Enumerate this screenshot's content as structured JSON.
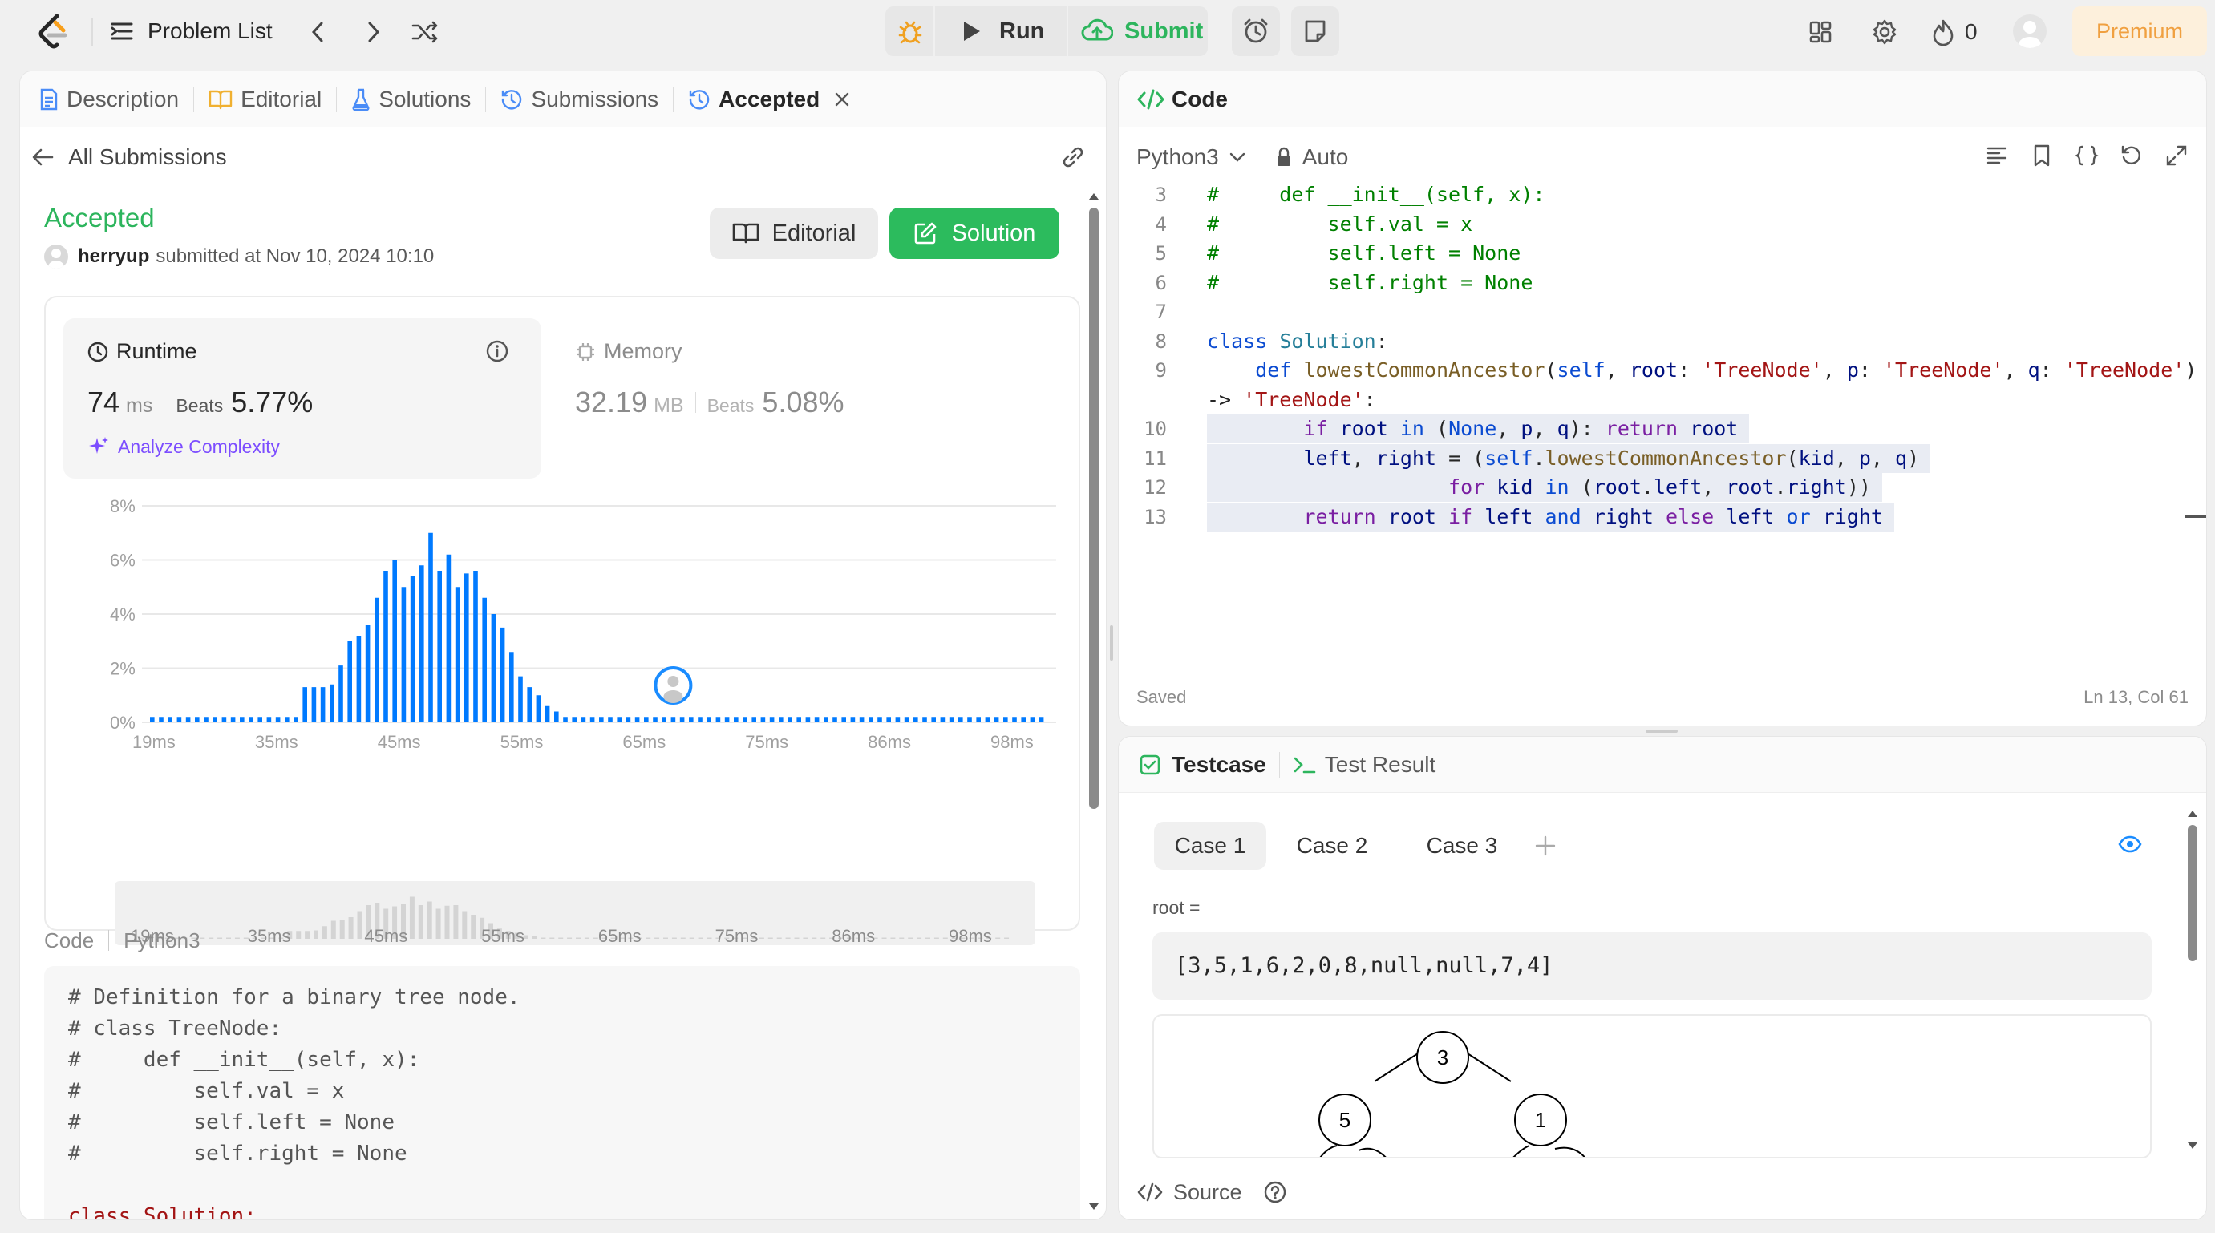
{
  "topbar": {
    "problem_list": "Problem List",
    "run": "Run",
    "submit": "Submit",
    "streak": "0",
    "premium": "Premium"
  },
  "left_tabs": {
    "description": "Description",
    "editorial": "Editorial",
    "solutions": "Solutions",
    "submissions": "Submissions",
    "accepted": "Accepted"
  },
  "submission": {
    "back_label": "All Submissions",
    "status": "Accepted",
    "user": "herryup",
    "submitted_text": "submitted at Nov 10, 2024 10:10",
    "editorial_btn": "Editorial",
    "solution_btn": "Solution"
  },
  "runtime": {
    "label": "Runtime",
    "value": "74",
    "unit": "ms",
    "beats_label": "Beats",
    "beats_value": "5.77%",
    "analyze": "Analyze Complexity"
  },
  "memory": {
    "label": "Memory",
    "value": "32.19",
    "unit": "MB",
    "beats_label": "Beats",
    "beats_value": "5.08%"
  },
  "chart_data": {
    "type": "bar",
    "y_ticks": [
      "8%",
      "6%",
      "4%",
      "2%",
      "0%"
    ],
    "ylim": [
      0,
      8
    ],
    "x_ticks": [
      "19ms",
      "35ms",
      "45ms",
      "55ms",
      "65ms",
      "75ms",
      "86ms",
      "98ms"
    ],
    "mini_x_ticks": [
      "19ms",
      "35ms",
      "45ms",
      "55ms",
      "65ms",
      "75ms",
      "86ms",
      "98ms"
    ],
    "values": [
      0.2,
      0.2,
      0.2,
      0.2,
      0.2,
      0.2,
      0.2,
      0.2,
      0.2,
      0.2,
      0.2,
      0.2,
      0.2,
      0.2,
      0.2,
      0.2,
      0.2,
      1.3,
      1.3,
      1.3,
      1.4,
      2.1,
      3.0,
      3.2,
      3.6,
      4.6,
      5.6,
      6.0,
      5.0,
      5.4,
      5.8,
      7.0,
      5.6,
      6.2,
      5.0,
      5.5,
      5.6,
      4.6,
      4.0,
      3.5,
      2.6,
      1.7,
      1.3,
      1.0,
      0.6,
      0.4,
      0.2,
      0.2,
      0.2,
      0.2,
      0.2,
      0.2,
      0.2,
      0.2,
      0.2,
      0.2,
      0.2,
      0.2,
      0.2,
      0.2,
      0.2,
      0.2,
      0.2,
      0.2,
      0.2,
      0.2,
      0.2,
      0.2,
      0.2,
      0.2,
      0.2,
      0.2,
      0.2,
      0.2,
      0.2,
      0.2,
      0.2,
      0.2,
      0.2,
      0.2,
      0.2,
      0.2,
      0.2,
      0.2,
      0.2,
      0.2,
      0.2,
      0.2,
      0.2,
      0.2,
      0.2,
      0.2,
      0.2,
      0.2,
      0.2,
      0.2,
      0.2,
      0.2,
      0.2,
      0.2
    ],
    "bar_color": "#007aff",
    "marker_index": 58
  },
  "code_section": {
    "label": "Code",
    "lang": "Python3",
    "lines": [
      "# Definition for a binary tree node.",
      "# class TreeNode:",
      "#     def __init__(self, x):",
      "#         self.val = x",
      "#         self.left = None",
      "#         self.right = None",
      "",
      "class Solution:"
    ]
  },
  "editor": {
    "title": "Code",
    "lang": "Python3",
    "mode": "Auto",
    "saved": "Saved",
    "position": "Ln 13, Col 61",
    "line_numbers": [
      "3",
      "4",
      "5",
      "6",
      "7",
      "8",
      "9",
      "",
      "10",
      "11",
      "12",
      "13"
    ]
  },
  "testcase": {
    "tab_testcase": "Testcase",
    "tab_result": "Test Result",
    "cases": [
      "Case 1",
      "Case 2",
      "Case 3"
    ],
    "var_label": "root =",
    "value": "[3,5,1,6,2,0,8,null,null,7,4]",
    "tree_nodes": [
      "3",
      "5",
      "1"
    ],
    "source": "Source"
  },
  "colors": {
    "accepted": "#2db55d",
    "solution_btn": "#2cbb5d",
    "premium_bg": "#fdf0dc",
    "premium_text": "#f0a040",
    "analyze": "#7c4dff"
  }
}
